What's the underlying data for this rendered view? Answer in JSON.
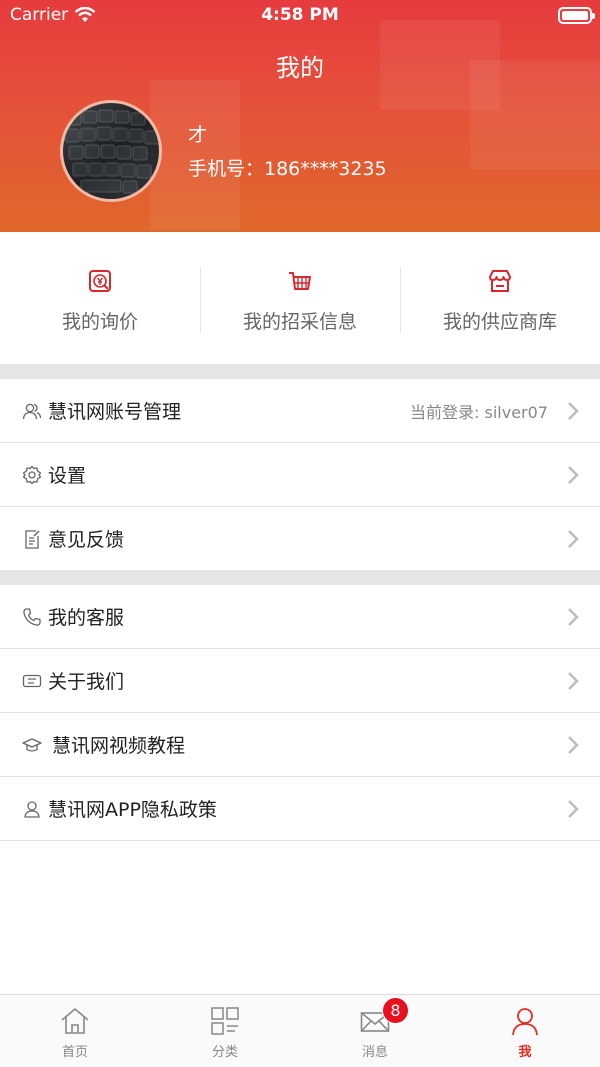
{
  "status_bar": {
    "carrier": "Carrier",
    "time": "4:58 PM"
  },
  "header": {
    "title": "我的"
  },
  "profile": {
    "name": "才",
    "phone": "手机号：186****3235"
  },
  "quick_actions": [
    {
      "label": "我的询价",
      "icon": "yuan-receipt-icon"
    },
    {
      "label": "我的招采信息",
      "icon": "basket-icon"
    },
    {
      "label": "我的供应商库",
      "icon": "store-icon"
    }
  ],
  "menu_group_1": [
    {
      "label": "慧讯网账号管理",
      "value": "当前登录: silver07",
      "icon": "users-icon"
    },
    {
      "label": "设置",
      "value": "",
      "icon": "gear-icon"
    },
    {
      "label": "意见反馈",
      "value": "",
      "icon": "feedback-icon"
    }
  ],
  "menu_group_2": [
    {
      "label": "我的客服",
      "icon": "phone-icon"
    },
    {
      "label": "关于我们",
      "icon": "ticket-icon"
    },
    {
      "label": "慧讯网视频教程",
      "icon": "graduation-cap-icon"
    },
    {
      "label": "慧讯网APP隐私政策",
      "icon": "user-icon"
    }
  ],
  "tabs": [
    {
      "label": "首页",
      "icon": "home-icon"
    },
    {
      "label": "分类",
      "icon": "category-icon"
    },
    {
      "label": "消息",
      "icon": "mail-icon",
      "badge": "8"
    },
    {
      "label": "我",
      "icon": "person-icon",
      "active": true
    }
  ],
  "colors": {
    "accent": "#e02e24",
    "header_top": "#e63b3f",
    "header_bottom": "#e0672b"
  }
}
